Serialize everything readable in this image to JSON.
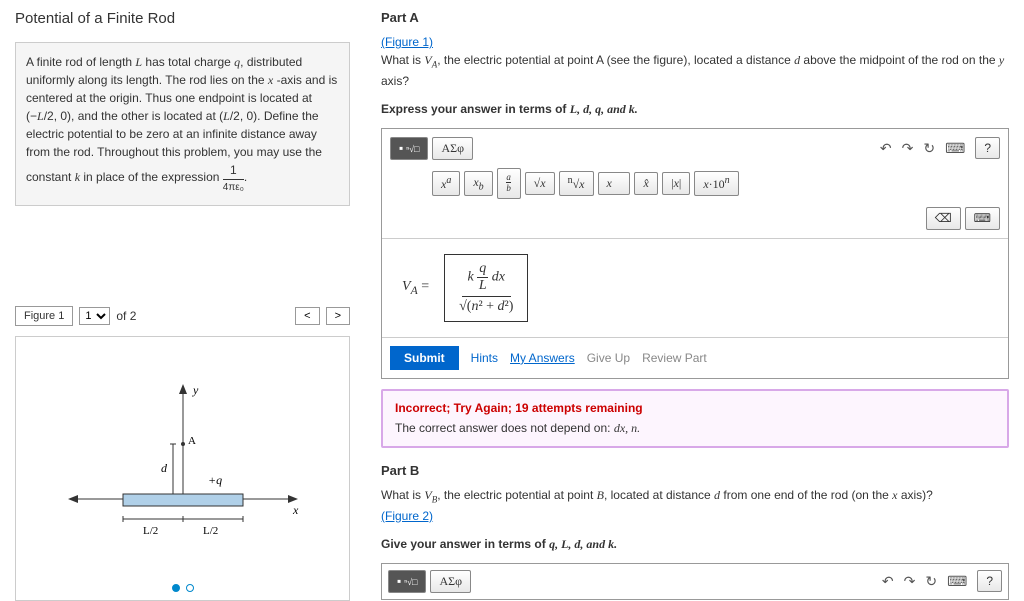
{
  "left": {
    "title": "Potential of a Finite Rod",
    "description_html": "A finite rod of length <i>L</i> has total charge <i>q</i>, distributed uniformly along its length. The rod lies on the <i>x</i> -axis and is centered at the origin. Thus one endpoint is located at (−<i>L</i>/2, 0), and the other is located at (<i>L</i>/2, 0). Define the electric potential to be zero at an infinite distance away from the rod. Throughout this problem, you may use the constant <i>k</i> in place of the expression 1/(4πε₀).",
    "figure_label": "Figure 1",
    "figure_count": "of 2"
  },
  "partA": {
    "title": "Part A",
    "figure_link": "(Figure 1)",
    "question_prefix": "What is ",
    "question_var": "V",
    "question_sub": "A",
    "question_rest": ", the electric potential at point A (see the figure), located a distance ",
    "question_d": "d",
    "question_end": " above the midpoint of the rod on the ",
    "question_y": "y",
    "question_axis": " axis?",
    "express": "Express your answer in terms of ",
    "terms": "L, d, q, and k.",
    "toolbar": {
      "templates": "ΑΣφ",
      "undo": "↶",
      "redo": "↷",
      "reset": "↻",
      "keyboard": "⌨",
      "help": "?",
      "x_sup": "xᵃ",
      "x_sub": "xᵦ",
      "frac": "a/b",
      "sqrt": "√x",
      "nroot": "ⁿ√x",
      "vec": "x⃗",
      "hat": "x̂",
      "abs": "|x|",
      "sci": "x·10ⁿ",
      "backspace": "⌫",
      "keyb2": "⌨"
    },
    "answer": {
      "label": "V",
      "sub": "A",
      "eq": "=",
      "num": "k (q/L) dx",
      "den": "√(n² + d²)"
    },
    "submit": "Submit",
    "hints": "Hints",
    "my_answers": "My Answers",
    "give_up": "Give Up",
    "review": "Review Part",
    "feedback": {
      "title": "Incorrect; Try Again; 19 attempts remaining",
      "msg_prefix": "The correct answer does not depend on: ",
      "msg_vars": "dx, n."
    }
  },
  "partB": {
    "title": "Part B",
    "question_prefix": "What is ",
    "question_var": "V",
    "question_sub": "B",
    "question_rest": ", the electric potential at point ",
    "question_point": "B",
    "question_rest2": ", located at distance ",
    "question_d": "d",
    "question_end": " from one end of the rod (on the ",
    "question_x": "x",
    "question_axis": " axis)?",
    "figure_link": "(Figure 2)",
    "express": "Give your answer in terms of ",
    "terms": "q, L, d, and k."
  }
}
